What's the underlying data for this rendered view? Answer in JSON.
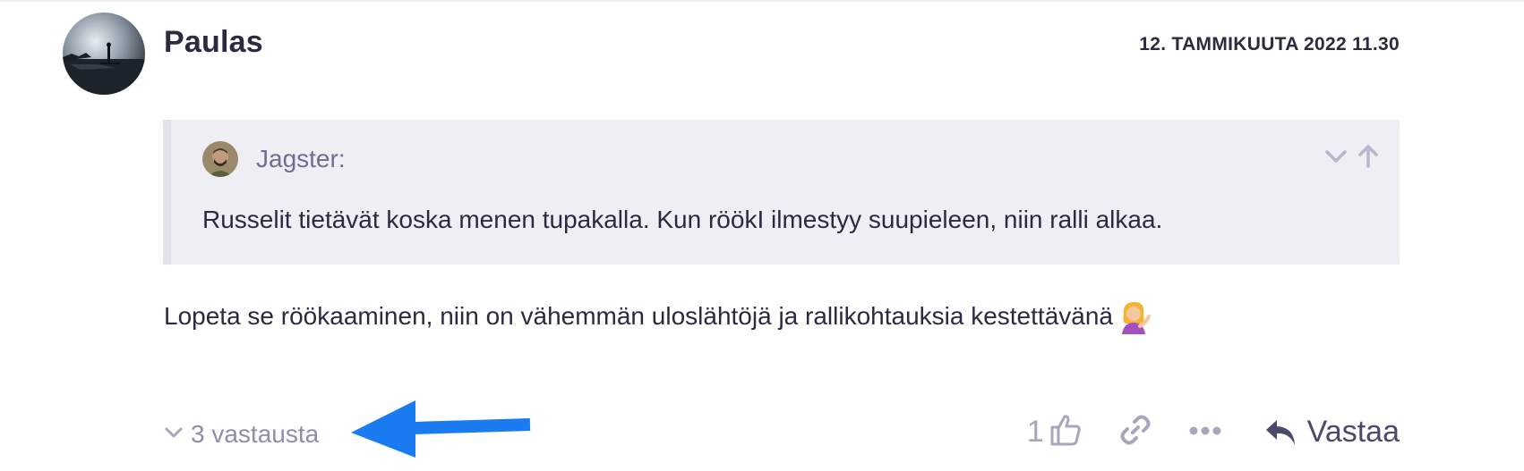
{
  "post": {
    "author": "Paulas",
    "timestamp": "12. TAMMIKUUTA 2022 11.30",
    "quote": {
      "author": "Jagster:",
      "text": "Russelit tietävät koska menen tupakalla. Kun röökI ilmestyy suupieleen, niin ralli alkaa."
    },
    "body": "Lopeta se röökaaminen, niin on vähemmän uloslähtöjä ja rallikohtauksia kestettävänä",
    "body_emoji": "person-tipping-hand-icon"
  },
  "footer": {
    "replies_label": "3 vastausta",
    "like_count": "1",
    "reply_label": "Vastaa"
  },
  "colors": {
    "text_dark": "#2b2a41",
    "muted": "#8f8da8",
    "quote_bg": "#efeef4",
    "annotation_arrow": "#1a7cf0"
  }
}
